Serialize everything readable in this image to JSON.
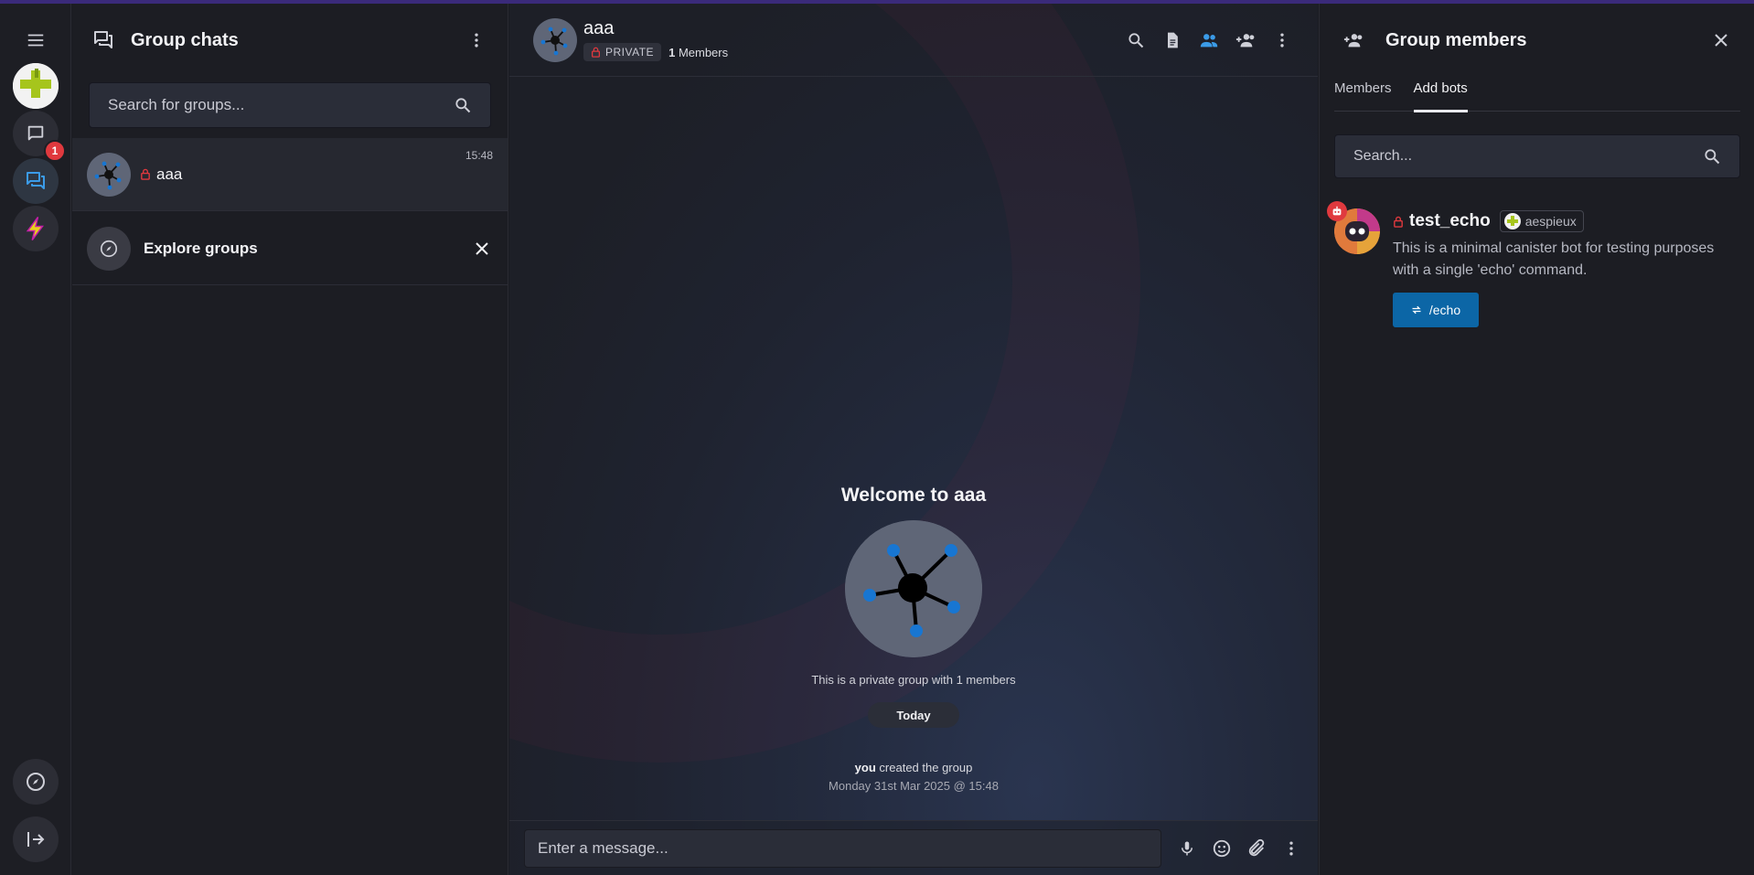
{
  "rail": {
    "unread_badge": "1"
  },
  "group_list": {
    "title": "Group chats",
    "search_placeholder": "Search for groups...",
    "chats": [
      {
        "name": "aaa",
        "time": "15:48",
        "private": true
      }
    ],
    "explore_label": "Explore groups"
  },
  "chat": {
    "name": "aaa",
    "privacy_label": "PRIVATE",
    "member_count": "1",
    "members_label": "Members",
    "welcome_title": "Welcome to aaa",
    "welcome_subtitle": "This is a private group with 1 members",
    "date_divider": "Today",
    "event_actor": "you",
    "event_text": "created the group",
    "event_timestamp": "Monday 31st Mar 2025 @ 15:48",
    "composer_placeholder": "Enter a message..."
  },
  "members_panel": {
    "title": "Group members",
    "tabs": [
      {
        "label": "Members",
        "active": false
      },
      {
        "label": "Add bots",
        "active": true
      }
    ],
    "search_placeholder": "Search...",
    "bot": {
      "name": "test_echo",
      "owner": "aespieux",
      "description": "This is a minimal canister bot for testing purposes with a single 'echo' command.",
      "command": "/echo"
    }
  },
  "colors": {
    "accent_blue": "#0c66a6",
    "active_icon": "#3b9be8",
    "lock_red": "#e0393e",
    "badge_red": "#e0393e"
  }
}
